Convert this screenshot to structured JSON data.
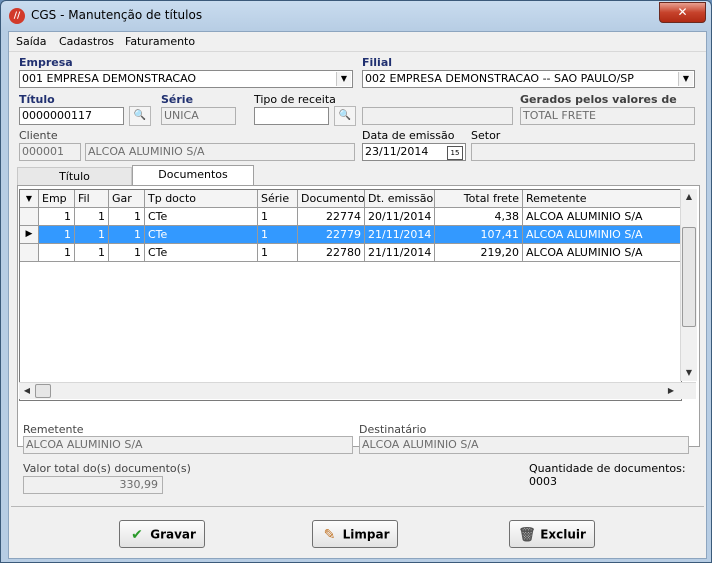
{
  "window": {
    "title": "CGS - Manutenção de títulos",
    "close_glyph": "✕"
  },
  "menu": [
    {
      "label": "Saída"
    },
    {
      "label": "Cadastros"
    },
    {
      "label": "Faturamento"
    }
  ],
  "form": {
    "empresa_label": "Empresa",
    "empresa_value": "001 EMPRESA DEMONSTRACAO",
    "filial_label": "Filial",
    "filial_value": "002 EMPRESA DEMONSTRACAO -- SAO PAULO/SP",
    "titulo_label": "Título",
    "titulo_value": "0000000117",
    "serie_label": "Série",
    "serie_value": "UNICA",
    "tipo_receita_label": "Tipo de receita",
    "tipo_receita_value": "",
    "tipo_receita_desc": "",
    "gerados_label": "Gerados pelos valores de",
    "gerados_value": "TOTAL FRETE",
    "cliente_label": "Cliente",
    "cliente_code": "000001",
    "cliente_name": "ALCOA ALUMINIO S/A",
    "data_emissao_label": "Data de emissão",
    "data_emissao_value": "23/11/2014",
    "setor_label": "Setor",
    "setor_value": ""
  },
  "tabs": [
    {
      "label": "Título",
      "active": false
    },
    {
      "label": "Documentos",
      "active": true
    }
  ],
  "grid": {
    "columns": [
      "Emp",
      "Fil",
      "Gar",
      "Tp docto",
      "Série",
      "Documento",
      "Dt. emissão",
      "Total frete",
      "Remetente"
    ],
    "rows": [
      {
        "emp": "1",
        "fil": "1",
        "gar": "1",
        "tp": "CTe",
        "serie": "1",
        "doc": "22774",
        "dt": "20/11/2014",
        "total": "4,38",
        "rem": "ALCOA ALUMINIO S/A",
        "selected": false
      },
      {
        "emp": "1",
        "fil": "1",
        "gar": "1",
        "tp": "CTe",
        "serie": "1",
        "doc": "22779",
        "dt": "21/11/2014",
        "total": "107,41",
        "rem": "ALCOA ALUMINIO S/A",
        "selected": true
      },
      {
        "emp": "1",
        "fil": "1",
        "gar": "1",
        "tp": "CTe",
        "serie": "1",
        "doc": "22780",
        "dt": "21/11/2014",
        "total": "219,20",
        "rem": "ALCOA ALUMINIO S/A",
        "selected": false
      }
    ]
  },
  "details": {
    "remetente_label": "Remetente",
    "remetente_value": "ALCOA ALUMINIO S/A",
    "destinatario_label": "Destinatário",
    "destinatario_value": "ALCOA ALUMINIO S/A",
    "valor_total_label": "Valor total do(s) documento(s)",
    "valor_total_value": "330,99",
    "quantidade_text": "Quantidade de documentos: 0003"
  },
  "buttons": {
    "gravar": "Gravar",
    "limpar": "Limpar",
    "excluir": "Excluir"
  },
  "colors": {
    "selection": "#3399ff",
    "label_blue": "#203070"
  }
}
